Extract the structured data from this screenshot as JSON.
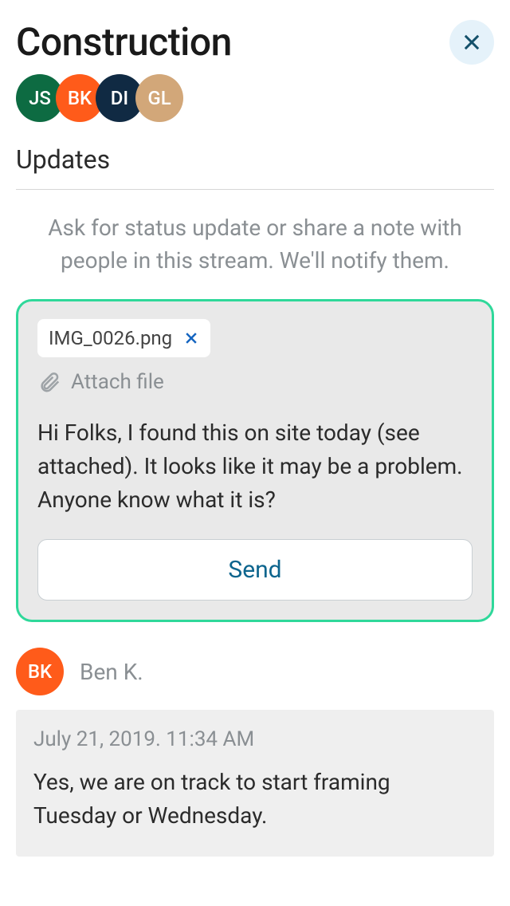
{
  "header": {
    "title": "Construction"
  },
  "participants": [
    {
      "initials": "JS",
      "bg": "#0d6b42"
    },
    {
      "initials": "BK",
      "bg": "#ff5b1a"
    },
    {
      "initials": "DI",
      "bg": "#102a43"
    },
    {
      "initials": "GL",
      "bg": "#d2a779"
    }
  ],
  "section_title": "Updates",
  "hint": "Ask for status update or share a note with people in this stream. We'll notify them.",
  "compose": {
    "attachment_name": "IMG_0026.png",
    "attach_label": "Attach file",
    "message": "Hi Folks, I found this on site today (see attached). It  looks like it may be a problem. Anyone know what it is?",
    "send_label": "Send"
  },
  "message": {
    "author_initials": "BK",
    "author_bg": "#ff5b1a",
    "author_name": "Ben K.",
    "timestamp": "July 21, 2019. 11:34 AM",
    "body": "Yes, we are on track to start framing Tuesday or Wednesday."
  }
}
